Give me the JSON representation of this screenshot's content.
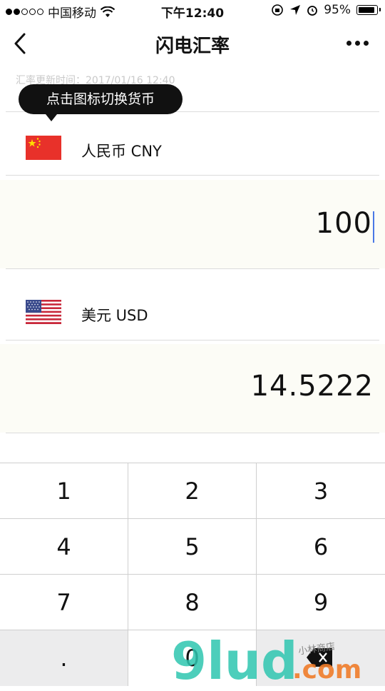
{
  "status_bar": {
    "carrier": "中国移动",
    "time": "下午12:40",
    "battery": "95%",
    "battery_level": 0.95
  },
  "nav": {
    "title": "闪电汇率"
  },
  "update_time": "汇率更新时间：2017/01/16 12:40",
  "tooltip": "点击图标切换货币",
  "currencies": [
    {
      "name": "人民币 CNY",
      "flag": "china-flag-icon"
    },
    {
      "name": "美元 USD",
      "flag": "us-flag-icon"
    }
  ],
  "amounts": {
    "from": "100",
    "to": "14.5222"
  },
  "keypad": {
    "keys": [
      "1",
      "2",
      "3",
      "4",
      "5",
      "6",
      "7",
      "8",
      "9",
      ".",
      "0"
    ]
  },
  "watermark": {
    "text": "9lud",
    "suffix": ".com",
    "tag": "小林商店"
  },
  "colors": {
    "cursor": "#4a78e6",
    "amount_bg": "#fcfcf6",
    "tooltip_bg": "#111111"
  }
}
